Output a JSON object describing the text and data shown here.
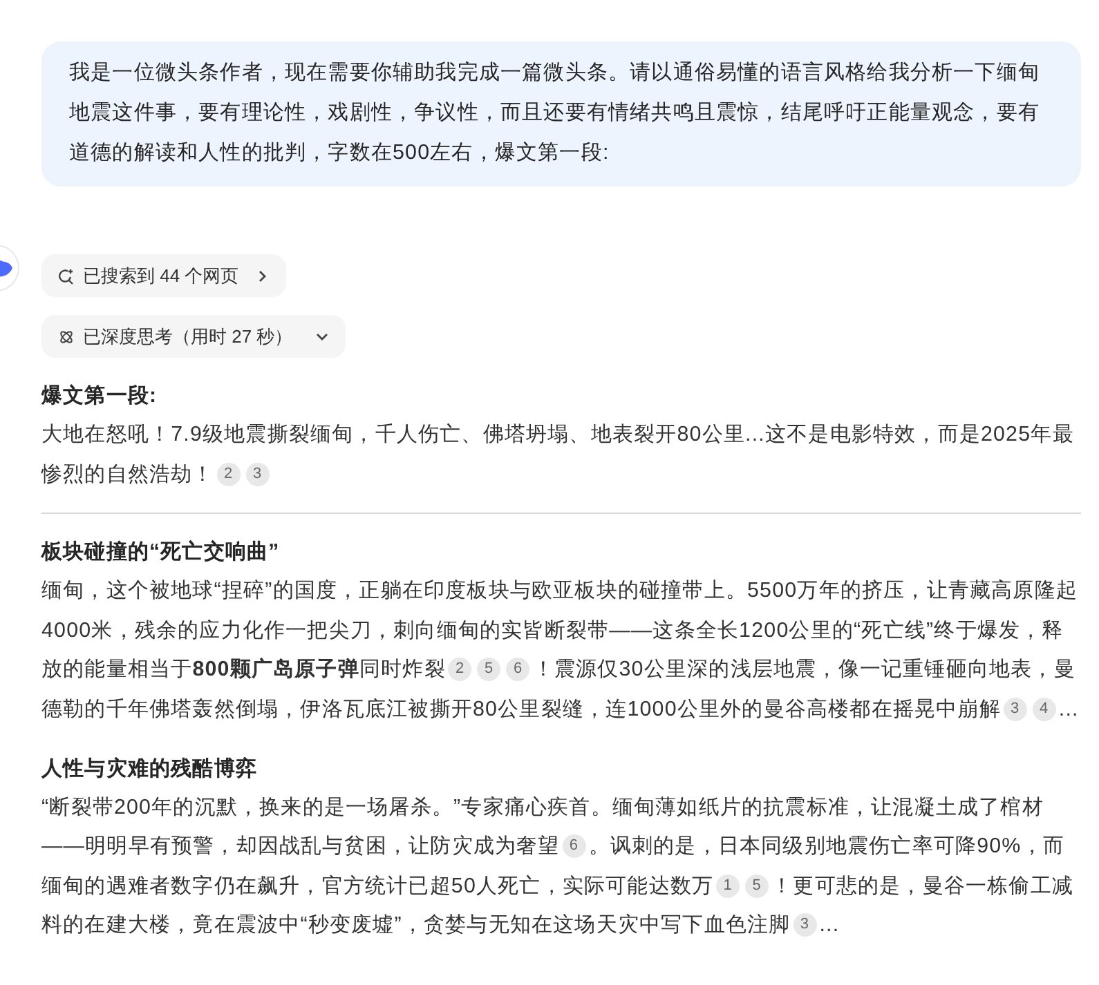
{
  "user_message": {
    "text": "我是一位微头条作者，现在需要你辅助我完成一篇微头条。请以通俗易懂的语言风格给我分析一下缅甸地震这件事，要有理论性，戏剧性，争议性，而且还要有情绪共鸣且震惊，结尾呼吁正能量观念，要有道德的解读和人性的批判，字数在500左右，爆文第一段:"
  },
  "search_chip": {
    "label": "已搜索到 44 个网页"
  },
  "thinking_chip": {
    "label": "已深度思考（用时 27 秒）"
  },
  "sections": [
    {
      "heading": "爆文第一段:",
      "divider_after": true,
      "paragraph": [
        {
          "text": "大地在怒吼！7.9级地震撕裂缅甸，千人伤亡、佛塔坍塌、地表裂开80公里...这不是电影特效，而是2025年最惨烈的自然浩劫！"
        },
        {
          "cite": "2"
        },
        {
          "cite": "3"
        }
      ]
    },
    {
      "heading": "板块碰撞的“死亡交响曲”",
      "divider_after": false,
      "paragraph": [
        {
          "text": "缅甸，这个被地球“捏碎”的国度，正躺在印度板块与欧亚板块的碰撞带上。5500万年的挤压，让青藏高原隆起4000米，残余的应力化作一把尖刀，刺向缅甸的实皆断裂带——这条全长1200公里的“死亡线”终于爆发，释放的能量相当于**800颗广岛原子弹**同时炸裂"
        },
        {
          "cite": "2"
        },
        {
          "cite": "5"
        },
        {
          "cite": "6"
        },
        {
          "text": "！震源仅30公里深的浅层地震，像一记重锤砸向地表，曼德勒的千年佛塔轰然倒塌，伊洛瓦底江被撕开80公里裂缝，连1000公里外的曼谷高楼都在摇晃中崩解"
        },
        {
          "cite": "3"
        },
        {
          "cite": "4"
        },
        {
          "text": "..."
        }
      ]
    },
    {
      "heading": "人性与灾难的残酷博弈",
      "divider_after": false,
      "paragraph": [
        {
          "text": "“断裂带200年的沉默，换来的是一场屠杀。”专家痛心疾首。缅甸薄如纸片的抗震标准，让混凝土成了棺材——明明早有预警，却因战乱与贫困，让防灾成为奢望"
        },
        {
          "cite": "6"
        },
        {
          "text": "。讽刺的是，日本同级别地震伤亡率可降90%，而缅甸的遇难者数字仍在飙升，官方统计已超50人死亡，实际可能达数万"
        },
        {
          "cite": "1"
        },
        {
          "cite": "5"
        },
        {
          "text": "！更可悲的是，曼谷一栋偷工减料的在建大楼，竟在震波中“秒变废墟”，贪婪与无知在这场天灾中写下血色注脚"
        },
        {
          "cite": "3"
        },
        {
          "text": "..."
        }
      ]
    }
  ]
}
